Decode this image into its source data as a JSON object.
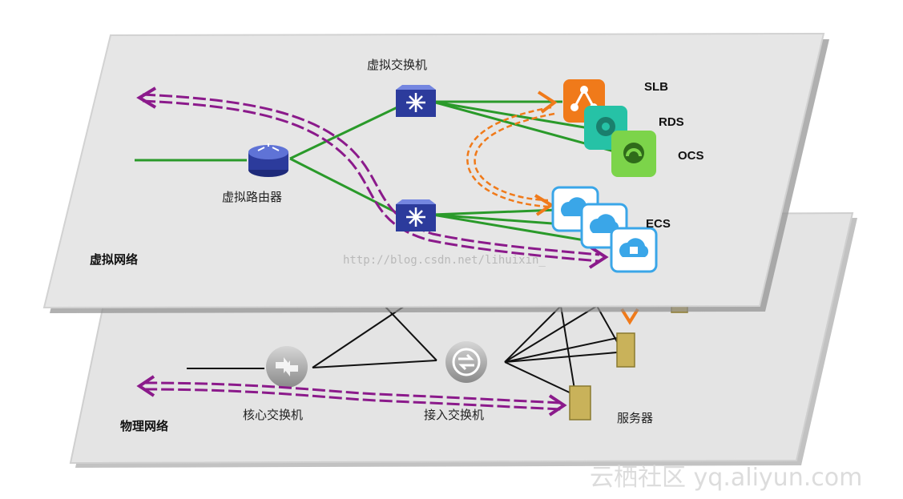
{
  "virtual": {
    "layer_label": "虚拟网络",
    "switch_label": "虚拟交换机",
    "router_label": "虚拟路由器",
    "slb_label": "SLB",
    "rds_label": "RDS",
    "ocs_label": "OCS",
    "ecs_label": "ECS"
  },
  "physical": {
    "layer_label": "物理网络",
    "core_switch_label": "核心交换机",
    "access_switch_label": "接入交换机",
    "server_label": "服务器"
  },
  "watermarks": {
    "url": "http://blog.csdn.net/lihuixin_",
    "site": "云栖社区 yq.aliyun.com"
  },
  "colors": {
    "plane_fill": "#e6e6e6",
    "green_link": "#2a9a2a",
    "purple_path": "#8b1a8b",
    "orange_path": "#f07a1a",
    "slb_icon": "#f07a1a",
    "rds_icon": "#26c2a6",
    "ocs_icon": "#7cd44a",
    "ecs_icon": "#3aa6e8",
    "server": "#c9b25a"
  },
  "icons": [
    "router-icon",
    "virtual-switch-icon",
    "slb-icon",
    "rds-icon",
    "ocs-icon",
    "ecs-icon",
    "core-switch-icon",
    "access-switch-icon",
    "server-icon"
  ]
}
